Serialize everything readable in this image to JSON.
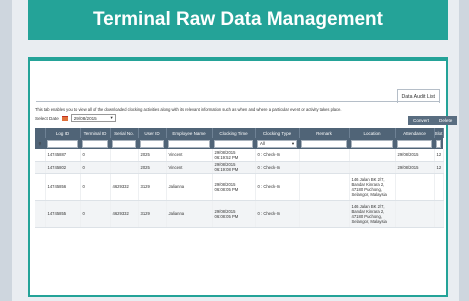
{
  "header": {
    "title": "Terminal Raw Data Management"
  },
  "tab": {
    "label": "Data Audit List"
  },
  "description": "This tab enables you to view all of the downloaded clocking activities along with its relevant information such as when and where a particular event or activity takes place.",
  "date_select": {
    "label": "Select Date",
    "value": "29/08/2015"
  },
  "buttons": {
    "convert": "Convert",
    "delete": "Delete"
  },
  "columns": [
    "Log ID",
    "Terminal ID",
    "Serial No.",
    "User ID",
    "Employee Name",
    "Clocking Time",
    "Clocking Type",
    "Remark",
    "Location",
    "Attendance",
    "Slot"
  ],
  "filter": {
    "clocking_type": "All"
  },
  "rows": [
    {
      "log_id": "14745887",
      "terminal_id": "0",
      "serial_no": "",
      "user_id": "2025",
      "employee_name": "Vincent",
      "clocking_time": "29/08/2015 06:19:52 PM",
      "clocking_type": "0 : Check-In",
      "remark": "",
      "location": "",
      "attendance": "29/08/2015",
      "slot": "12"
    },
    {
      "log_id": "14745802",
      "terminal_id": "0",
      "serial_no": "",
      "user_id": "2025",
      "employee_name": "Vincent",
      "clocking_time": "29/08/2015 06:19:08 PM",
      "clocking_type": "0 : Check-In",
      "remark": "",
      "location": "",
      "attendance": "29/08/2015",
      "slot": "12"
    },
    {
      "log_id": "14745856",
      "terminal_id": "0",
      "serial_no": "4629332",
      "user_id": "3129",
      "employee_name": "Jalianna",
      "clocking_time": "29/08/2015 06:08:05 PM",
      "clocking_type": "0 : Check-In",
      "remark": "",
      "location": "146 Jalan BK 2/7, Bandar Kinrara 2, 47180 Puchong, Selangor, Malaysia",
      "attendance": "",
      "slot": ""
    },
    {
      "log_id": "14745855",
      "terminal_id": "0",
      "serial_no": "4629332",
      "user_id": "3129",
      "employee_name": "Jalianna",
      "clocking_time": "29/08/2015 06:08:05 PM",
      "clocking_type": "0 : Check-In",
      "remark": "",
      "location": "146 Jalan BK 2/7, Bandar Kinrara 2, 47180 Puchong, Selangor, Malaysia",
      "attendance": "",
      "slot": ""
    }
  ]
}
